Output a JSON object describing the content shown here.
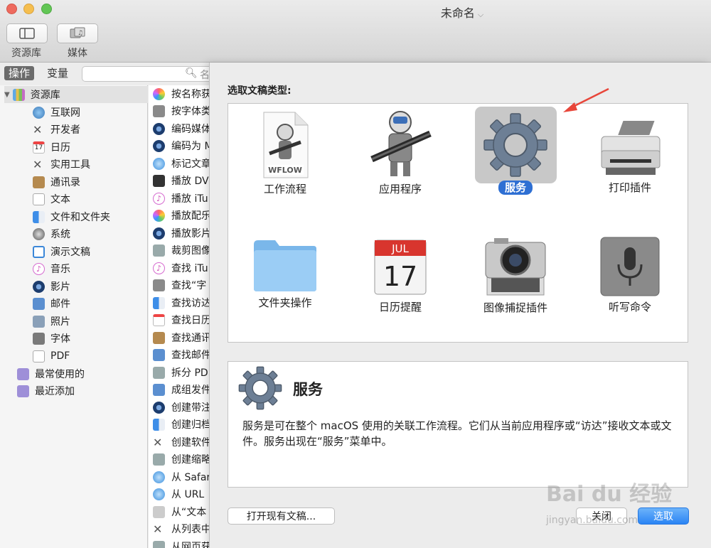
{
  "window": {
    "title": "未命名"
  },
  "toolbar": {
    "library_label": "资源库",
    "media_label": "媒体"
  },
  "left_header": {
    "actions_tab": "操作",
    "variables_tab": "变量",
    "search_placeholder": "名"
  },
  "library": {
    "root": "资源库",
    "items": [
      "互联网",
      "开发者",
      "日历",
      "实用工具",
      "通讯录",
      "文本",
      "文件和文件夹",
      "系统",
      "演示文稿",
      "音乐",
      "影片",
      "邮件",
      "照片",
      "字体",
      "PDF"
    ],
    "extra": [
      "最常使用的",
      "最近添加"
    ],
    "calendar_day": "17"
  },
  "actions": [
    "按名称获",
    "按字体类",
    "编码媒体",
    "编码为 M",
    "标记文章",
    "播放 DV",
    "播放 iTu",
    "播放配乐",
    "播放影片",
    "裁剪图像",
    "查找 iTu",
    "查找“字",
    "查找访达",
    "查找日历",
    "查找通讯",
    "查找邮件",
    "拆分 PD",
    "成组发件",
    "创建带注",
    "创建归档",
    "创建软件",
    "创建缩略",
    "从 Safar",
    "从 URL",
    "从“文本",
    "从列表中",
    "从网页获得链接 URL"
  ],
  "dialog": {
    "heading": "选取文稿类型:",
    "types": [
      {
        "label": "工作流程",
        "badge": "WFLOW"
      },
      {
        "label": "应用程序"
      },
      {
        "label": "服务",
        "selected": true
      },
      {
        "label": "打印插件"
      },
      {
        "label": "文件夹操作"
      },
      {
        "label": "日历提醒",
        "month": "JUL",
        "day": "17"
      },
      {
        "label": "图像捕捉插件"
      },
      {
        "label": "听写命令"
      }
    ],
    "description": {
      "title": "服务",
      "text": "服务是可在整个 macOS 使用的关联工作流程。它们从当前应用程序或“访达”接收文本或文件。服务出现在“服务”菜单中。"
    },
    "buttons": {
      "open": "打开现有文稿...",
      "close": "关闭",
      "choose": "选取"
    }
  },
  "watermark": {
    "logo": "Bai du 经验",
    "url": "jingyan.baidu.com"
  },
  "colors": {
    "accent": "#2e6fd3",
    "choose_button": "#2a84f4",
    "annotation_arrow": "#e8463a"
  }
}
